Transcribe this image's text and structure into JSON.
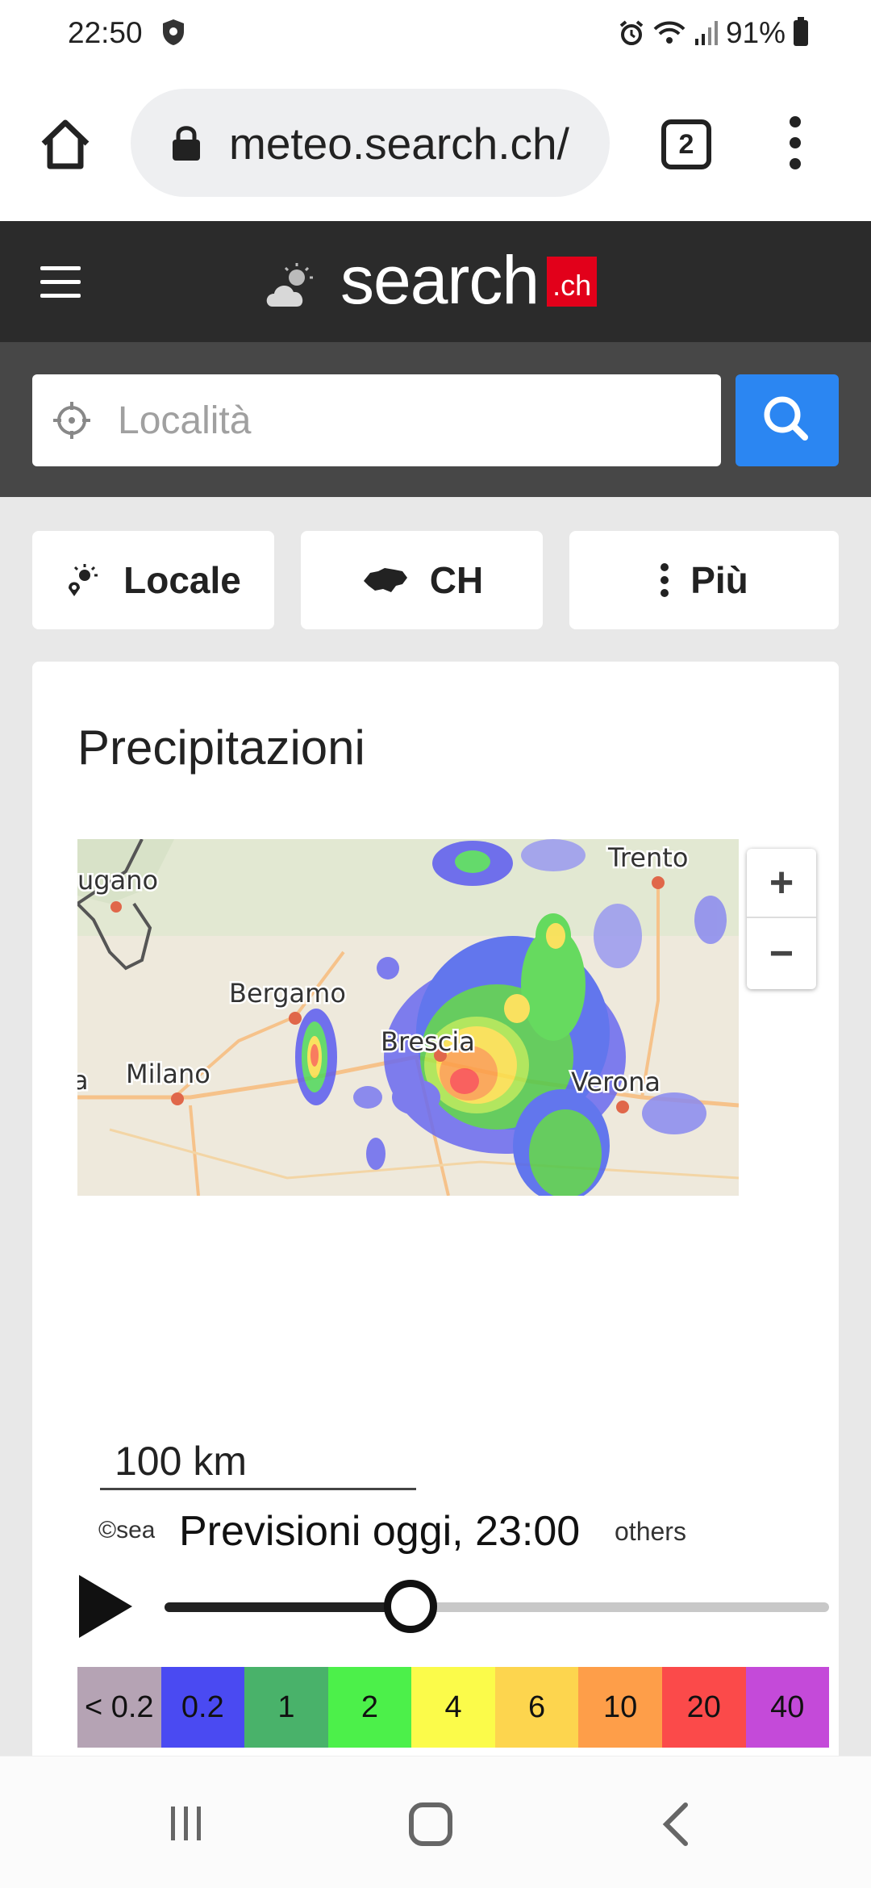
{
  "status_bar": {
    "time": "22:50",
    "battery": "91%"
  },
  "browser": {
    "url": "meteo.search.ch/",
    "tab_count": "2"
  },
  "header": {
    "logo_text": "search",
    "logo_suffix": ".ch"
  },
  "search": {
    "placeholder": "Località"
  },
  "nav": {
    "local_label": "Locale",
    "ch_label": "CH",
    "more_label": "Più"
  },
  "card": {
    "title": "Precipitazioni",
    "map_labels": [
      "Lugano",
      "Trento",
      "Bergamo",
      "Milano",
      "Brescia",
      "Verona"
    ],
    "zoom_in": "+",
    "zoom_out": "−",
    "scale": "100 km",
    "copyright": "©search.ch",
    "forecast": "Previsioni oggi, 23:00",
    "others": "others",
    "slider_value": 0.37
  },
  "legend": [
    {
      "label": "< 0.2",
      "color": "#b5a3b4"
    },
    {
      "label": "0.2",
      "color": "#4a4af2"
    },
    {
      "label": "1",
      "color": "#49b26a"
    },
    {
      "label": "2",
      "color": "#4cf04a"
    },
    {
      "label": "4",
      "color": "#fbfb4a"
    },
    {
      "label": "6",
      "color": "#fdd54e"
    },
    {
      "label": "10",
      "color": "#fe9e49"
    },
    {
      "label": "20",
      "color": "#fb4a4a"
    },
    {
      "label": "40",
      "color": "#c44ad9"
    }
  ],
  "colors": {
    "header_bg": "#2b2b2b",
    "search_button": "#2b86f2",
    "brand_red": "#e2001a"
  }
}
